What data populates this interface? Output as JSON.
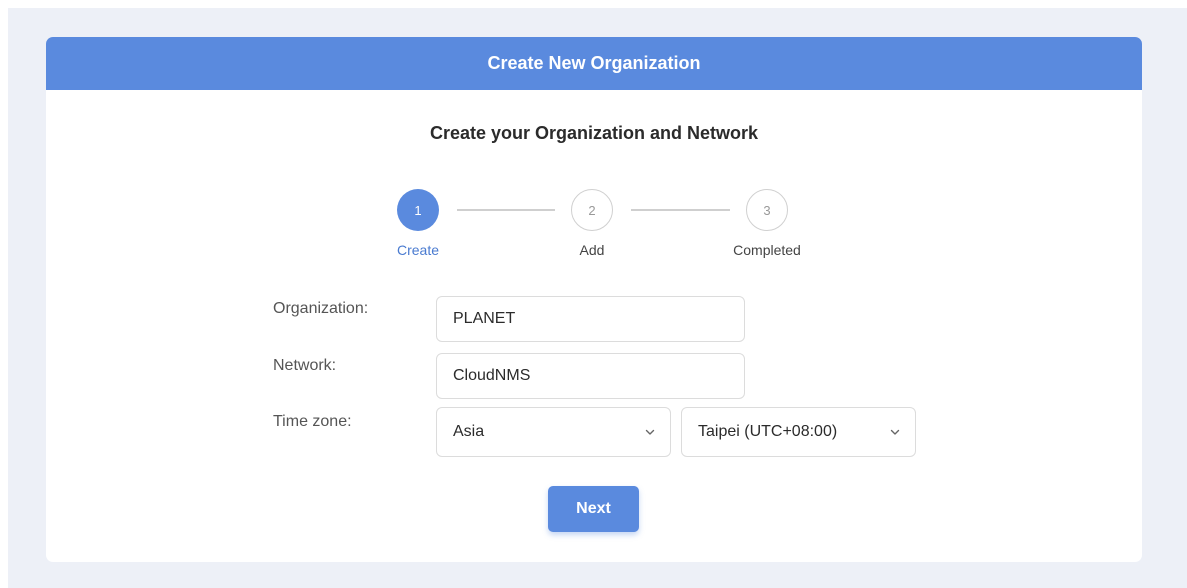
{
  "header": {
    "title": "Create New Organization"
  },
  "subtitle": "Create your Organization and Network",
  "steps": [
    {
      "number": "1",
      "label": "Create",
      "state": "active"
    },
    {
      "number": "2",
      "label": "Add",
      "state": "inactive"
    },
    {
      "number": "3",
      "label": "Completed",
      "state": "inactive"
    }
  ],
  "form": {
    "organization": {
      "label": "Organization:",
      "value": "PLANET"
    },
    "network": {
      "label": "Network:",
      "value": "CloudNMS"
    },
    "timezone": {
      "label": "Time zone:",
      "region": "Asia",
      "city": "Taipei (UTC+08:00)"
    }
  },
  "next_label": "Next",
  "colors": {
    "accent": "#5a8ade",
    "page_background": "#edf0f7"
  }
}
